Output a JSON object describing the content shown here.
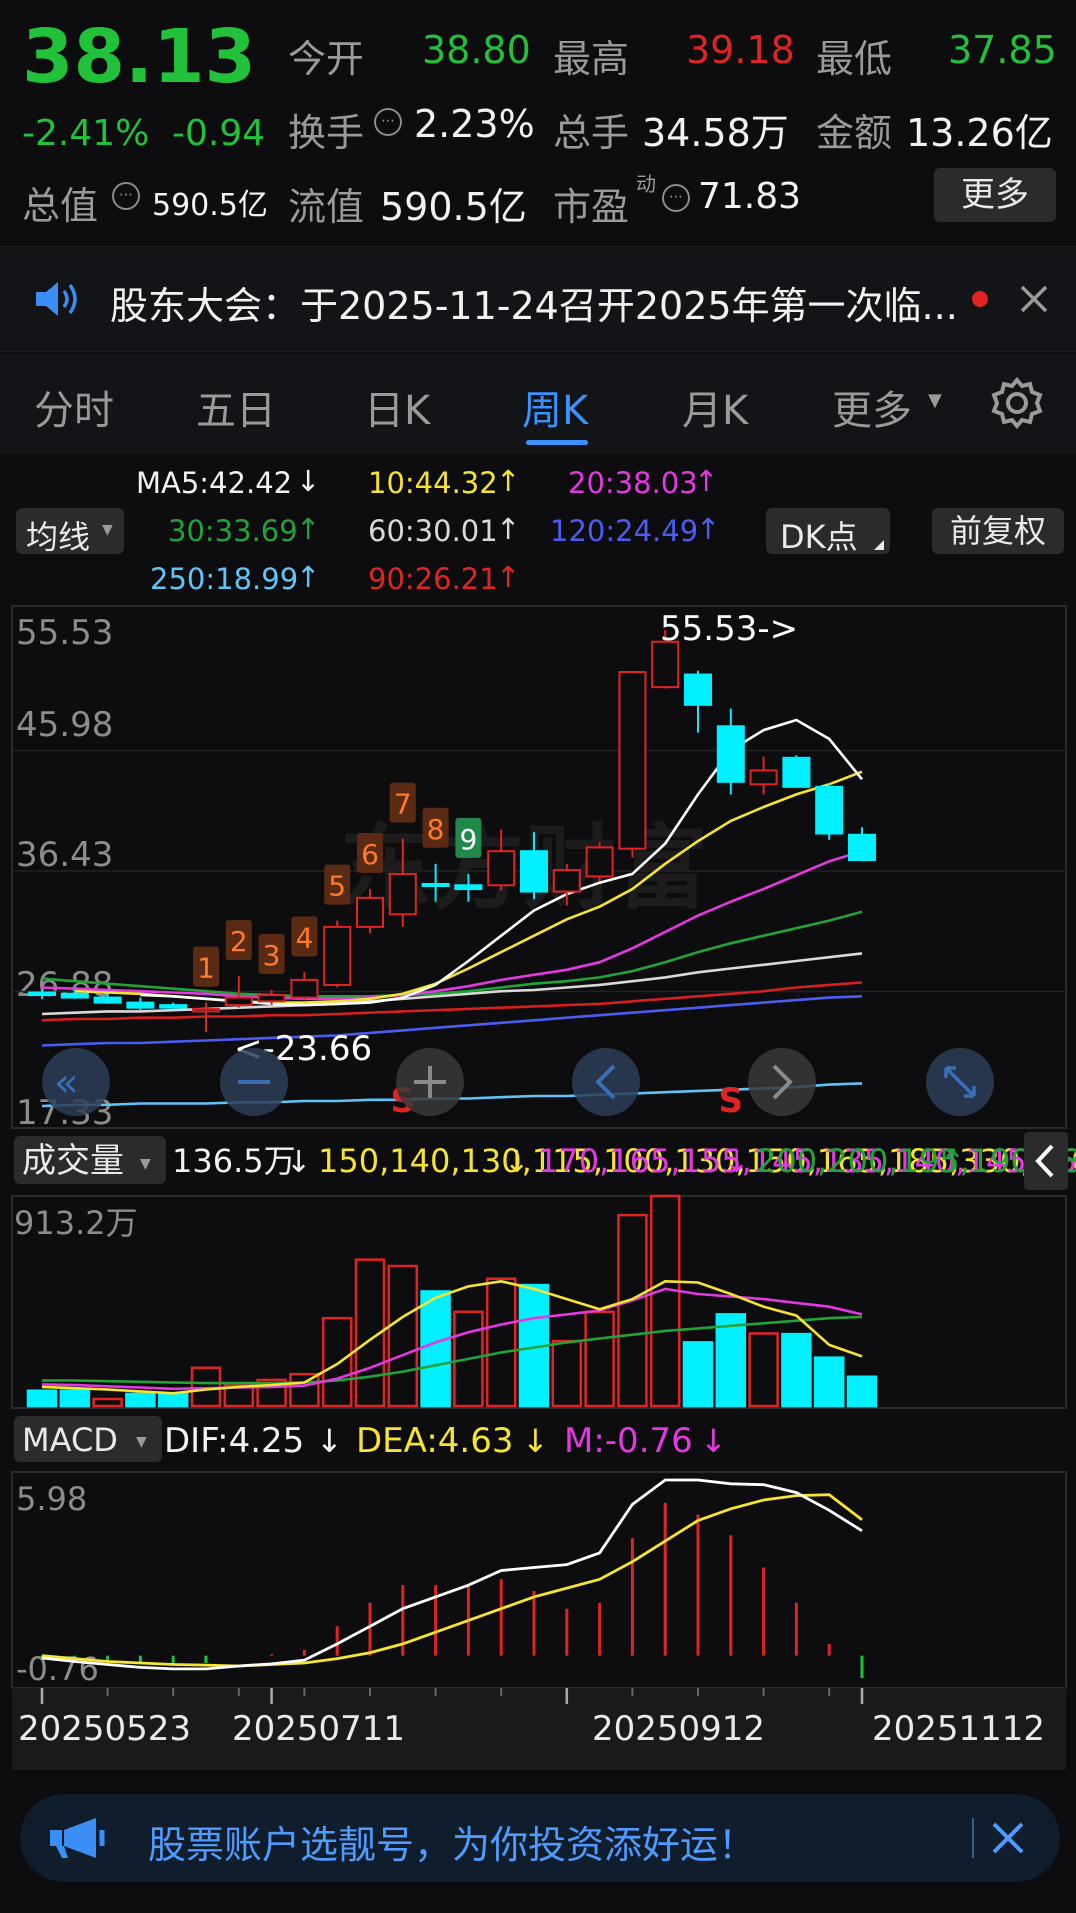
{
  "quote": {
    "price": "38.13",
    "change_pct": "-2.41%",
    "change_abs": "-0.94",
    "open_label": "今开",
    "open": "38.80",
    "high_label": "最高",
    "high": "39.18",
    "low_label": "最低",
    "low": "37.85",
    "turnover_label": "换手",
    "turnover": "2.23%",
    "volume_label": "总手",
    "volume": "34.58万",
    "amount_label": "金额",
    "amount": "13.26亿",
    "mktcap_label": "总值",
    "mktcap": "590.5亿",
    "float_label": "流值",
    "float": "590.5亿",
    "pe_label": "市盈",
    "pe_superscript": "动",
    "pe": "71.83",
    "more_button": "更多"
  },
  "notice": {
    "text": "股东大会：于2025-11-24召开2025年第一次临..."
  },
  "tabs": [
    "分时",
    "五日",
    "日K",
    "周K",
    "月K",
    "更多"
  ],
  "active_tab": 3,
  "ma_legend": {
    "ma_button": "均线",
    "ma5": "MA5:42.42",
    "ma10": "10:44.32",
    "ma20": "20:38.03",
    "ma30": "30:33.69",
    "ma60": "60:30.01",
    "ma120": "120:24.49",
    "ma250": "250:18.99",
    "ma90": "90:26.21",
    "dk_button": "DK点",
    "adjust_button": "前复权"
  },
  "colors": {
    "up": "#e02424",
    "down": "#00f0ff",
    "green": "#22c13a",
    "ma5": "#ffffff",
    "ma10": "#f5e431",
    "ma20": "#e339e0",
    "ma30": "#22a33a",
    "ma60": "#d9d9d9",
    "ma90": "#d42020",
    "ma120": "#4a5df0",
    "ma250": "#60c4f7"
  },
  "chart_data": [
    {
      "type": "candlestick",
      "title": "周K",
      "y_ticks": [
        "55.53",
        "45.98",
        "36.43",
        "26.88",
        "17.33"
      ],
      "ylim": [
        17.33,
        55.53
      ],
      "x_labels": [
        "20250523",
        "20250711",
        "20250912",
        "20251112"
      ],
      "candles": [
        {
          "o": 26.8,
          "h": 27.0,
          "l": 26.3,
          "c": 26.6
        },
        {
          "o": 26.7,
          "h": 27.0,
          "l": 26.3,
          "c": 26.4
        },
        {
          "o": 26.4,
          "h": 26.7,
          "l": 25.9,
          "c": 26.0
        },
        {
          "o": 26.0,
          "h": 26.4,
          "l": 25.4,
          "c": 25.6
        },
        {
          "o": 25.8,
          "h": 26.0,
          "l": 25.5,
          "c": 25.6
        },
        {
          "o": 25.3,
          "h": 26.0,
          "l": 23.66,
          "c": 25.5
        },
        {
          "o": 25.8,
          "h": 28.1,
          "l": 25.6,
          "c": 26.4
        },
        {
          "o": 26.1,
          "h": 27.0,
          "l": 25.8,
          "c": 26.6
        },
        {
          "o": 26.4,
          "h": 28.4,
          "l": 26.2,
          "c": 27.8
        },
        {
          "o": 27.4,
          "h": 32.5,
          "l": 27.2,
          "c": 32.0
        },
        {
          "o": 32.0,
          "h": 35.0,
          "l": 31.5,
          "c": 34.3
        },
        {
          "o": 33.0,
          "h": 39.0,
          "l": 32.0,
          "c": 36.2
        },
        {
          "o": 35.4,
          "h": 37.0,
          "l": 34.0,
          "c": 35.3
        },
        {
          "o": 35.3,
          "h": 36.2,
          "l": 34.0,
          "c": 35.0
        },
        {
          "o": 35.3,
          "h": 39.7,
          "l": 34.9,
          "c": 38.0
        },
        {
          "o": 38.0,
          "h": 39.5,
          "l": 34.2,
          "c": 34.8
        },
        {
          "o": 34.8,
          "h": 37.0,
          "l": 33.7,
          "c": 36.5
        },
        {
          "o": 36.0,
          "h": 38.7,
          "l": 35.6,
          "c": 38.3
        },
        {
          "o": 38.2,
          "h": 52.2,
          "l": 37.5,
          "c": 52.2
        },
        {
          "o": 51.0,
          "h": 55.53,
          "l": 50.9,
          "c": 54.6
        },
        {
          "o": 52.0,
          "h": 52.3,
          "l": 47.4,
          "c": 49.6
        },
        {
          "o": 47.9,
          "h": 49.3,
          "l": 42.5,
          "c": 43.5
        },
        {
          "o": 43.3,
          "h": 45.5,
          "l": 42.5,
          "c": 44.4
        },
        {
          "o": 45.4,
          "h": 45.6,
          "l": 43.2,
          "c": 43.1
        },
        {
          "o": 43.1,
          "h": 43.4,
          "l": 38.9,
          "c": 39.4
        },
        {
          "o": 39.3,
          "h": 39.9,
          "l": 37.2,
          "c": 37.3
        }
      ],
      "ma5": [
        26.6,
        26.5,
        26.3,
        26.1,
        25.9,
        25.8,
        25.9,
        26.0,
        26.4,
        27.4,
        29.3,
        31.3,
        33.3,
        34.6,
        35.5,
        36.2,
        38.6,
        42.5,
        46.0,
        47.6,
        48.4,
        46.9,
        43.7
      ],
      "ma10": [
        26.9,
        26.8,
        26.7,
        26.5,
        26.3,
        26.1,
        26.0,
        26.0,
        26.1,
        26.3,
        26.7,
        27.5,
        28.7,
        30.0,
        31.3,
        32.6,
        33.6,
        35.0,
        37.0,
        38.8,
        40.4,
        41.5,
        42.5,
        43.3,
        44.3
      ],
      "ma20": [
        27.2,
        27.1,
        27.0,
        26.9,
        26.8,
        26.7,
        26.5,
        26.4,
        26.3,
        26.3,
        26.4,
        26.6,
        26.9,
        27.3,
        27.8,
        28.2,
        28.6,
        29.2,
        30.3,
        31.6,
        32.9,
        34.0,
        35.0,
        36.1,
        37.2,
        38.0
      ],
      "ma30": [
        27.9,
        27.7,
        27.5,
        27.3,
        27.1,
        26.9,
        26.7,
        26.6,
        26.5,
        26.5,
        26.5,
        26.6,
        26.7,
        26.9,
        27.2,
        27.5,
        27.7,
        28.0,
        28.5,
        29.2,
        30.0,
        30.7,
        31.3,
        31.9,
        32.5,
        33.2
      ],
      "ma60": [
        25.1,
        25.2,
        25.3,
        25.3,
        25.4,
        25.5,
        25.6,
        25.7,
        25.8,
        25.9,
        26.1,
        26.3,
        26.5,
        26.7,
        26.9,
        27.0,
        27.2,
        27.4,
        27.7,
        28.0,
        28.4,
        28.7,
        29.0,
        29.3,
        29.6,
        29.9
      ],
      "ma90": [
        24.6,
        24.7,
        24.7,
        24.8,
        24.8,
        24.9,
        24.9,
        25.0,
        25.0,
        25.1,
        25.2,
        25.3,
        25.4,
        25.5,
        25.6,
        25.7,
        25.8,
        25.9,
        26.1,
        26.3,
        26.5,
        26.7,
        26.9,
        27.2,
        27.4,
        27.6
      ],
      "ma120": [
        22.6,
        22.7,
        22.8,
        22.8,
        22.9,
        23.0,
        23.1,
        23.2,
        23.3,
        23.4,
        23.6,
        23.8,
        24.0,
        24.2,
        24.4,
        24.6,
        24.8,
        25.0,
        25.2,
        25.4,
        25.6,
        25.8,
        26.0,
        26.2,
        26.4,
        26.5
      ],
      "ma250": [
        17.8,
        17.9,
        17.9,
        18.0,
        18.0,
        18.0,
        18.1,
        18.1,
        18.2,
        18.2,
        18.3,
        18.3,
        18.4,
        18.4,
        18.5,
        18.6,
        18.6,
        18.7,
        18.8,
        18.9,
        19.0,
        19.1,
        19.2,
        19.3,
        19.5,
        19.6
      ],
      "annotations": {
        "max_label": "55.53->",
        "min_label": "<-23.66",
        "counts": [
          {
            "i": 5,
            "t": "1",
            "kind": "buy"
          },
          {
            "i": 6,
            "t": "2",
            "kind": "buy"
          },
          {
            "i": 7,
            "t": "3",
            "kind": "buy"
          },
          {
            "i": 8,
            "t": "4",
            "kind": "buy"
          },
          {
            "i": 9,
            "t": "5",
            "kind": "buy"
          },
          {
            "i": 10,
            "t": "6",
            "kind": "buy"
          },
          {
            "i": 11,
            "t": "7",
            "kind": "buy"
          },
          {
            "i": 12,
            "t": "8",
            "kind": "buy"
          },
          {
            "i": 13,
            "t": "9",
            "kind": "sell"
          }
        ],
        "signals": [
          {
            "i": 11,
            "t": "S"
          },
          {
            "i": 21,
            "t": "S"
          }
        ]
      }
    },
    {
      "type": "bar",
      "title": "成交量",
      "value_label": "136.5万",
      "ma1": [
        150,
        140,
        130,
        115,
        100,
        130,
        150,
        165,
        185,
        330,
        520,
        700,
        850,
        940,
        980,
        920,
        840,
        760,
        840,
        980,
        970,
        880,
        780,
        710,
        480,
        390
      ],
      "ma2": [
        170,
        165,
        155,
        145,
        135,
        140,
        145,
        150,
        160,
        215,
        300,
        400,
        500,
        580,
        640,
        690,
        720,
        750,
        830,
        920,
        880,
        860,
        840,
        810,
        780,
        720
      ],
      "ma3": [
        200,
        200,
        195,
        190,
        185,
        180,
        180,
        180,
        185,
        200,
        230,
        270,
        320,
        370,
        420,
        460,
        500,
        530,
        560,
        590,
        610,
        630,
        650,
        670,
        690,
        700
      ],
      "max_label": "913.2万",
      "values": [
        120,
        120,
        55,
        95,
        95,
        300,
        160,
        205,
        250,
        690,
        1150,
        1100,
        900,
        740,
        1000,
        950,
        510,
        740,
        1500,
        1650,
        500,
        720,
        570,
        565,
        380,
        230
      ],
      "up": [
        false,
        false,
        true,
        false,
        false,
        true,
        true,
        true,
        true,
        true,
        true,
        true,
        false,
        true,
        true,
        false,
        true,
        true,
        true,
        true,
        false,
        false,
        true,
        false,
        false,
        false
      ]
    },
    {
      "type": "macd",
      "title": "MACD",
      "dif_label": "DIF:4.25",
      "dea_label": "DEA:4.63",
      "m_label": "M:-0.76",
      "y_ticks": [
        "5.98",
        "-0.76"
      ],
      "ylim": [
        -0.76,
        5.98
      ],
      "dif": [
        -0.08,
        -0.2,
        -0.3,
        -0.4,
        -0.45,
        -0.45,
        -0.35,
        -0.28,
        -0.15,
        0.4,
        1.0,
        1.6,
        2.0,
        2.4,
        2.9,
        3.0,
        3.1,
        3.5,
        5.15,
        5.98,
        5.98,
        5.85,
        5.82,
        5.55,
        4.95,
        4.25
      ],
      "dea": [
        -0.0,
        -0.1,
        -0.2,
        -0.25,
        -0.3,
        -0.32,
        -0.35,
        -0.3,
        -0.25,
        -0.1,
        0.1,
        0.4,
        0.8,
        1.2,
        1.6,
        2.0,
        2.3,
        2.6,
        3.2,
        3.9,
        4.6,
        5.0,
        5.3,
        5.45,
        5.48,
        4.63
      ],
      "m": [
        -0.15,
        -0.2,
        -0.2,
        -0.3,
        -0.3,
        -0.25,
        0.0,
        0.05,
        0.2,
        1.0,
        1.8,
        2.4,
        2.4,
        2.4,
        2.6,
        2.2,
        1.6,
        1.8,
        4.0,
        5.2,
        4.8,
        4.1,
        3.0,
        1.8,
        0.4,
        -0.76
      ]
    }
  ],
  "ad_banner": {
    "text": "股票账户选靓号，为你投资添好运！"
  }
}
